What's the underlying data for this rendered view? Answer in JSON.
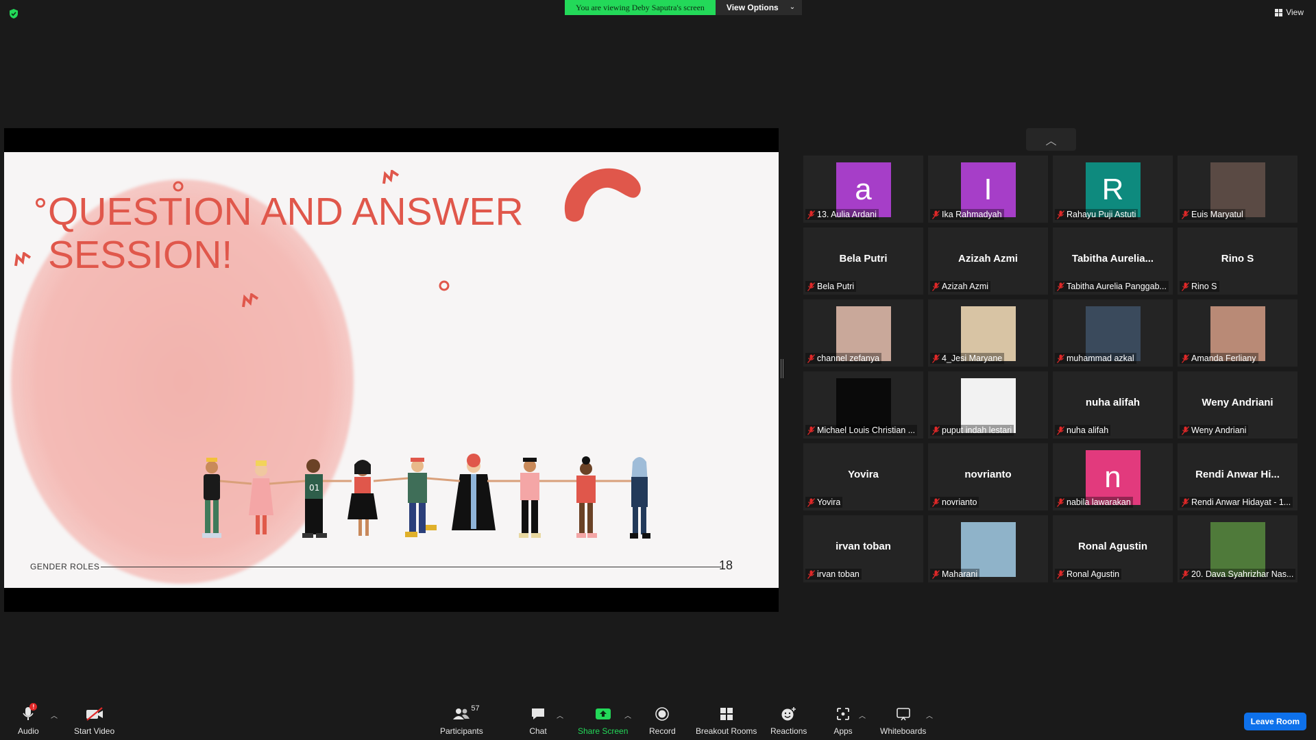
{
  "banner": {
    "viewing_text": "You are viewing Deby Saputra's screen",
    "view_options_label": "View Options"
  },
  "top_right": {
    "view_label": "View"
  },
  "slide": {
    "title": "QUESTION AND ANSWER SESSION!",
    "footer_label": "GENDER ROLES",
    "page_number": "18",
    "accent_color": "#e0574b"
  },
  "participants": [
    {
      "label": "13. Aulia Ardani",
      "display": "a",
      "kind": "letter",
      "color": "#a63ec8",
      "muted": true
    },
    {
      "label": "Ika Rahmadyah",
      "display": "I",
      "kind": "letter",
      "color": "#a63ec8",
      "muted": true
    },
    {
      "label": "Rahayu Puji Astuti",
      "display": "R",
      "kind": "letter",
      "color": "#0e8a7e",
      "muted": true
    },
    {
      "label": "Euis Maryatul",
      "display": "",
      "kind": "photo",
      "color": "#5a4a44",
      "muted": true
    },
    {
      "label": "Bela Putri",
      "display": "Bela Putri",
      "kind": "name",
      "muted": true
    },
    {
      "label": "Azizah Azmi",
      "display": "Azizah Azmi",
      "kind": "name",
      "muted": true
    },
    {
      "label": "Tabitha Aurelia Panggab...",
      "display": "Tabitha  Aurelia...",
      "kind": "name",
      "muted": true
    },
    {
      "label": "Rino S",
      "display": "Rino S",
      "kind": "name",
      "muted": true
    },
    {
      "label": "channel zefanya",
      "display": "",
      "kind": "photo",
      "color": "#c9a89a",
      "muted": true
    },
    {
      "label": "4_Jesi Maryane",
      "display": "",
      "kind": "photo",
      "color": "#d8c4a4",
      "muted": true
    },
    {
      "label": "muhammad azkal",
      "display": "",
      "kind": "photo",
      "color": "#3a4a5c",
      "muted": true
    },
    {
      "label": "Amanda Ferliany",
      "display": "",
      "kind": "photo",
      "color": "#b98a76",
      "muted": true
    },
    {
      "label": "Michael Louis Christian ...",
      "display": "",
      "kind": "photo",
      "color": "#0a0a0a",
      "muted": true
    },
    {
      "label": "puput indah lestari",
      "display": "",
      "kind": "photo",
      "color": "#f2f2f2",
      "muted": true
    },
    {
      "label": "nuha alifah",
      "display": "nuha alifah",
      "kind": "name",
      "muted": true
    },
    {
      "label": "Weny Andriani",
      "display": "Weny Andriani",
      "kind": "name",
      "muted": true
    },
    {
      "label": "Yovira",
      "display": "Yovira",
      "kind": "name",
      "muted": true
    },
    {
      "label": "novrianto",
      "display": "novrianto",
      "kind": "name",
      "muted": true
    },
    {
      "label": "nabila lawarakan",
      "display": "n",
      "kind": "letter",
      "color": "#e23a7d",
      "muted": true
    },
    {
      "label": "Rendi Anwar Hidayat - 1...",
      "display": "Rendi  Anwar  Hi...",
      "kind": "name",
      "muted": true
    },
    {
      "label": "irvan toban",
      "display": "irvan toban",
      "kind": "name",
      "muted": true
    },
    {
      "label": "Maharani",
      "display": "",
      "kind": "photo",
      "color": "#8fb3c9",
      "muted": true
    },
    {
      "label": "Ronal Agustin",
      "display": "Ronal Agustin",
      "kind": "name",
      "muted": true
    },
    {
      "label": "20. Dava Syahrizhar Nas...",
      "display": "",
      "kind": "photo",
      "color": "#4f7a3a",
      "muted": true
    }
  ],
  "toolbar": {
    "audio_label": "Audio",
    "audio_badge": "!",
    "video_label": "Start Video",
    "participants_label": "Participants",
    "participants_count": "57",
    "chat_label": "Chat",
    "share_label": "Share Screen",
    "record_label": "Record",
    "breakout_label": "Breakout Rooms",
    "reactions_label": "Reactions",
    "apps_label": "Apps",
    "whiteboards_label": "Whiteboards",
    "leave_label": "Leave Room"
  }
}
